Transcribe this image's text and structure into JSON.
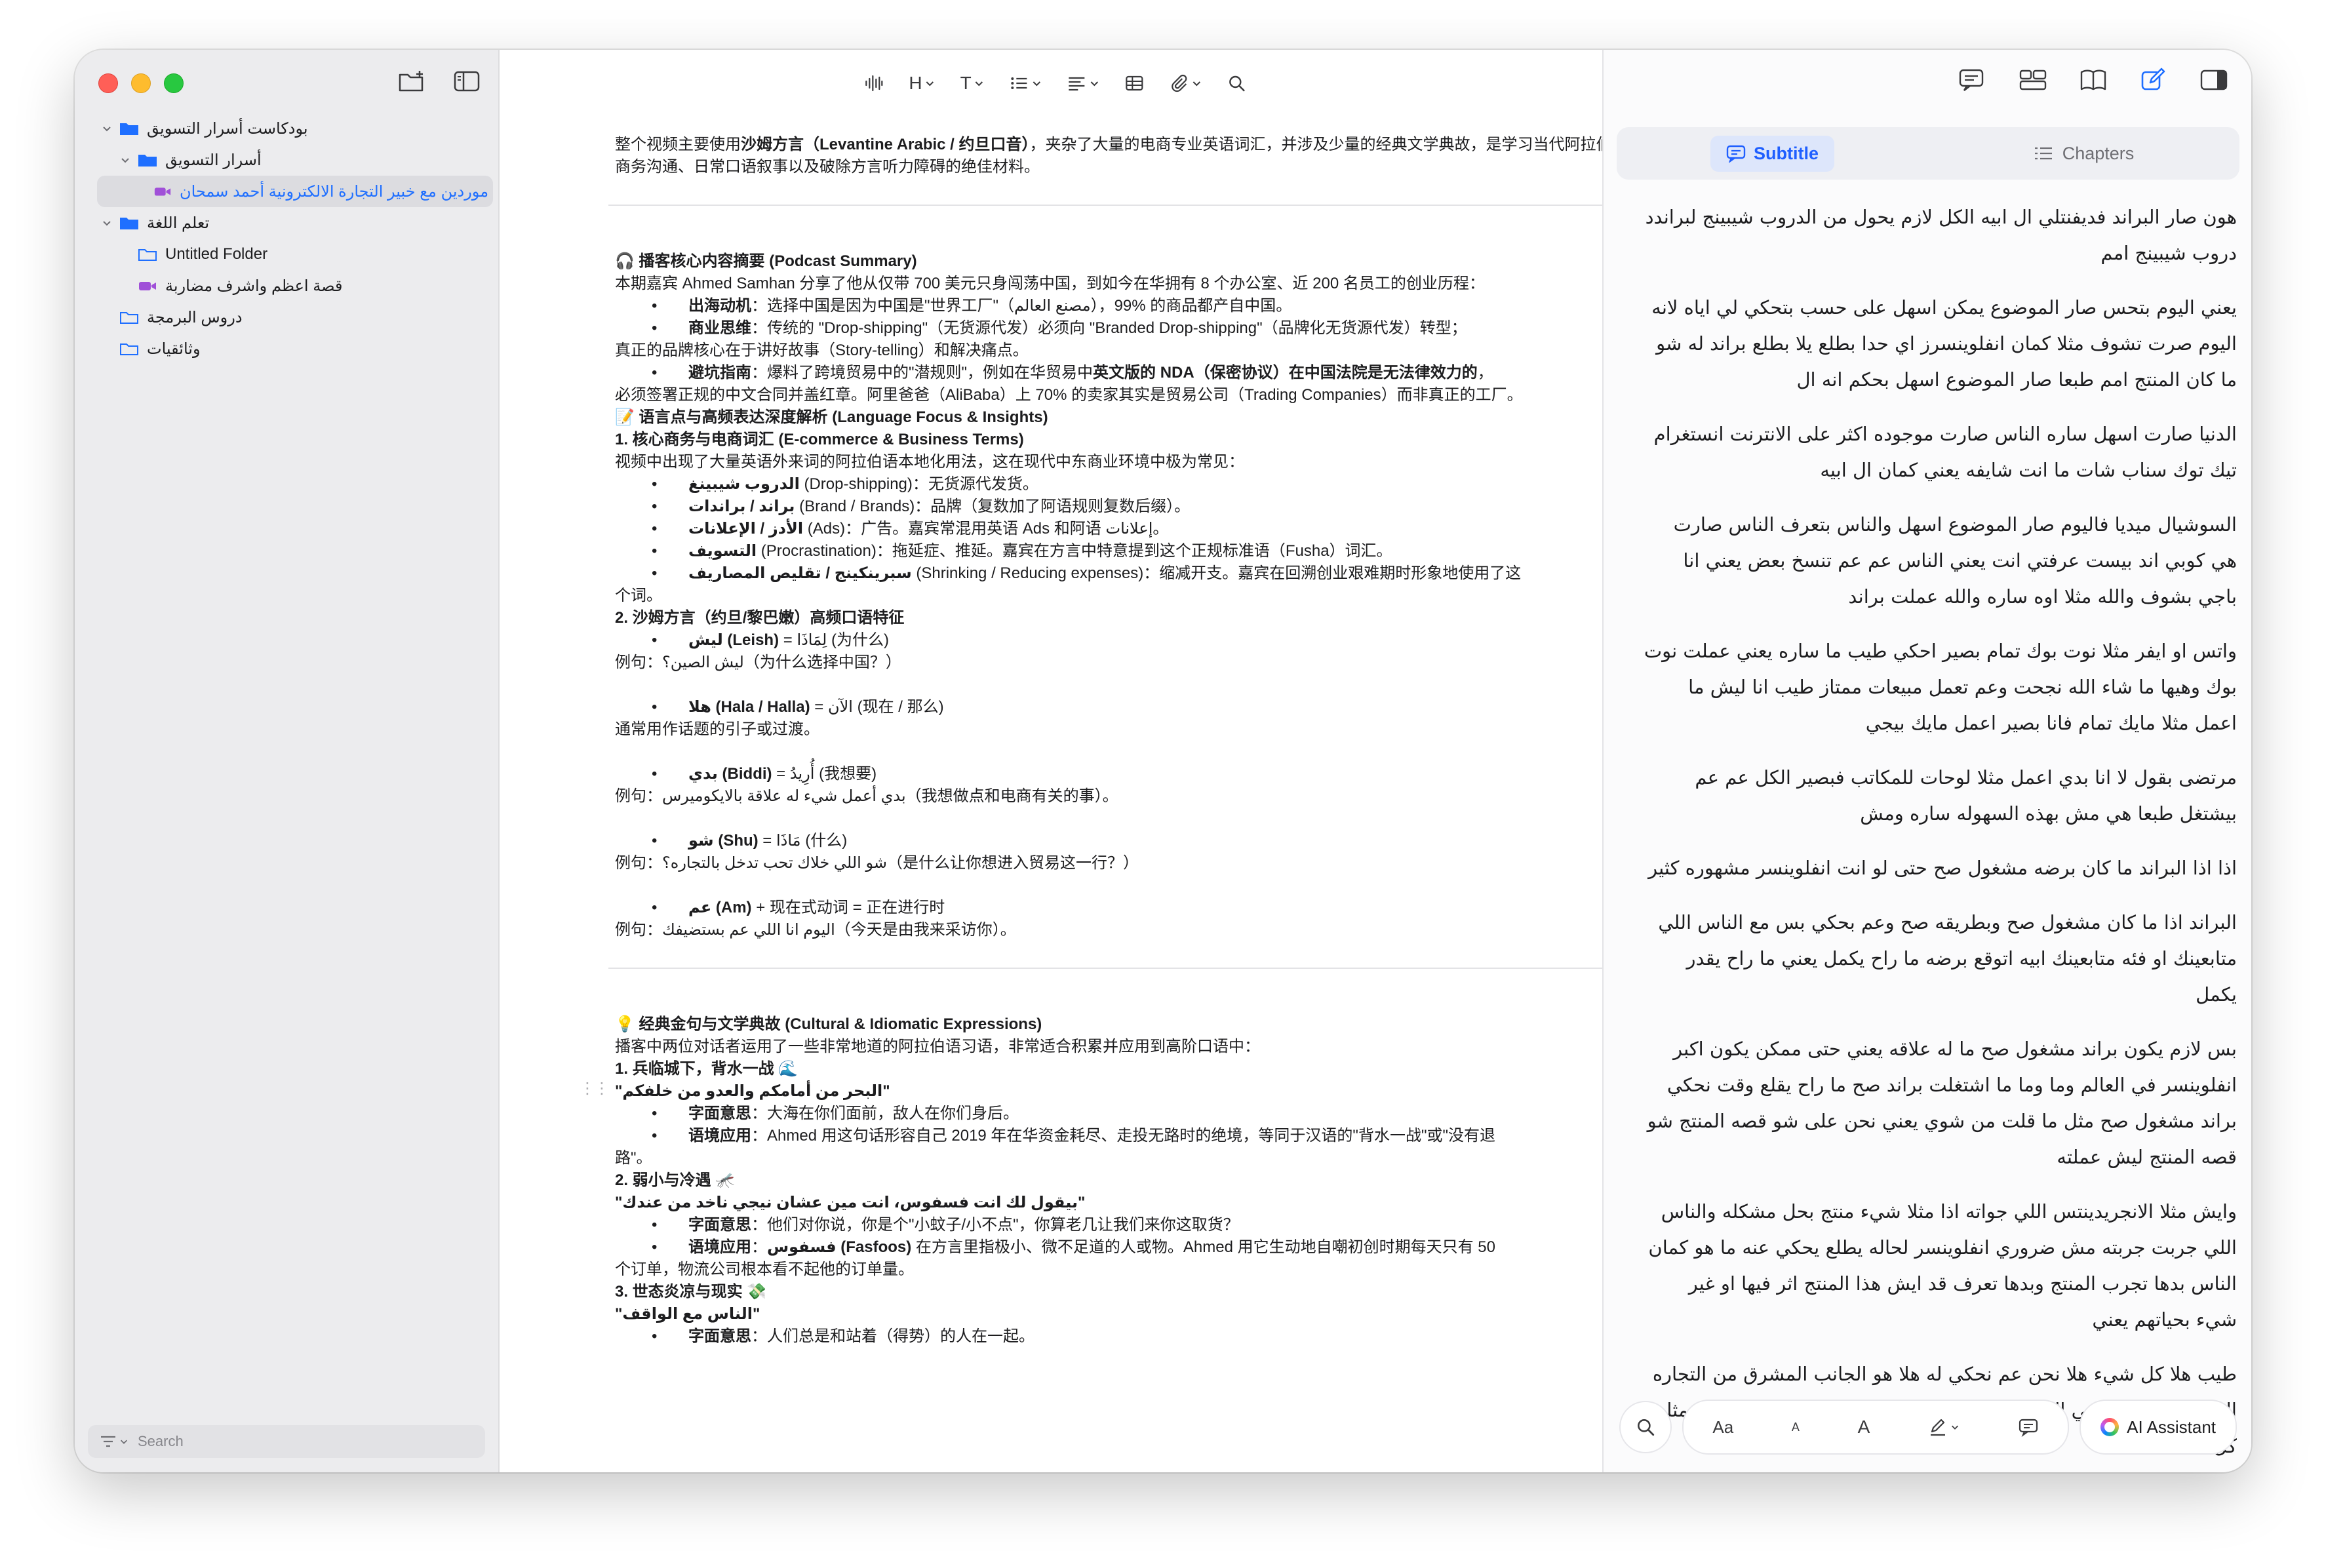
{
  "sidebar": {
    "tree": [
      {
        "label": "بودكاست أسرار التسويق",
        "level": 0,
        "expanded": true,
        "type": "folder-filled"
      },
      {
        "label": "أسرار التسويق",
        "level": 1,
        "expanded": true,
        "type": "folder-filled"
      },
      {
        "label": "موردين مع خبير التجارة الالكترونية أحمد سمحان",
        "level": 2,
        "type": "video",
        "selected": true
      },
      {
        "label": "تعلم اللغة",
        "level": 0,
        "expanded": true,
        "type": "folder-filled"
      },
      {
        "label": "Untitled Folder",
        "level": 1,
        "type": "folder-outline"
      },
      {
        "label": "قصة اعظم واشرف مضاربة",
        "level": 1,
        "type": "video"
      },
      {
        "label": "دروس البرمجة",
        "level": 0,
        "type": "folder-outline"
      },
      {
        "label": "وثائقيات",
        "level": 0,
        "type": "folder-outline"
      }
    ],
    "search_placeholder": "Search"
  },
  "toolbar": {
    "heading": "H",
    "text": "T"
  },
  "doc": {
    "p1a": "整个视频主要使用",
    "p1b": "沙姆方言（Levantine Arabic / 约旦口音）",
    "p1c": "，夹杂了大量的电商专业英语词汇，并涉及少量的经典文学典故，是学习当代阿拉伯语商务沟通、日常口语叙事以及破除方言听力障碍的绝佳材料。",
    "s1_title": "🎧 播客核心内容摘要 (Podcast Summary)",
    "s1_intro": "本期嘉宾 Ahmed Samhan 分享了他从仅带 700 美元只身闯荡中国，到如今在华拥有 8 个办公室、近 200 名员工的创业历程：",
    "b1_head": "出海动机",
    "b1_text": "：选择中国是因为中国是\"世界工厂\"（مصنع العالم），99% 的商品都产自中国。",
    "b2_head": "商业思维",
    "b2_text": "：传统的 \"Drop-shipping\"（无货源代发）必须向 \"Branded Drop-shipping\"（品牌化无货源代发）转型；",
    "b2_cont": "真正的品牌核心在于讲好故事（Story-telling）和解决痛点。",
    "b3_head": "避坑指南",
    "b3_text_a": "：爆料了跨境贸易中的\"潜规则\"，例如在华贸易中",
    "b3_text_b": "英文版的 NDA（保密协议）在中国法院是无法律效力的",
    "b3_text_c": "，",
    "b3_cont": "必须签署正规的中文合同并盖红章。阿里爸爸（AliBaba）上 70% 的卖家其实是贸易公司（Trading Companies）而非真正的工厂。",
    "s2_title": "📝 语言点与高频表达深度解析 (Language Focus & Insights)",
    "s2_h1": "1. 核心商务与电商词汇 (E-commerce & Business Terms)",
    "s2_intro": "视频中出现了大量英语外来词的阿拉伯语本地化用法，这在现代中东商业环境中极为常见：",
    "v1_head": "الدروب شيبينغ",
    "v1_text": " (Drop-shipping)：无货源代发货。",
    "v2_head": "براند / براندات",
    "v2_text": " (Brand / Brands)：品牌（复数加了阿语规则复数后缀）。",
    "v3_head": "الأدز / الإعلانات",
    "v3_text": " (Ads)：广告。嘉宾常混用英语 Ads 和阿语 إعلانات。",
    "v4_head": "التسويف",
    "v4_text": " (Procrastination)：拖延症、推延。嘉宾在方言中特意提到这个正规标准语（Fusha）词汇。",
    "v5_head": "سبرينكينج / تقليص المصاريف",
    "v5_text": " (Shrinking / Reducing expenses)：缩减开支。嘉宾在回溯创业艰难期时形象地使用了这",
    "v5_cont": "个词。",
    "s2_h2": "2. 沙姆方言（约旦/黎巴嫩）高频口语特征",
    "d1_head": "ليش (Leish)",
    "d1_text": " = لِمَاذَا (为什么)",
    "d1_ex": "例句：ليش الصين؟（为什么选择中国？）",
    "d2_head": "هلا (Hala / Halla)",
    "d2_text": " = الآن (现在 / 那么)",
    "d2_ex": "通常用作话题的引子或过渡。",
    "d3_head": "بدي (Biddi)",
    "d3_text": " = أُرِيدُ (我想要)",
    "d3_ex": "例句：بدي أعمل شيء له علاقة بالايكوميرس（我想做点和电商有关的事）。",
    "d4_head": "شو (Shu)",
    "d4_text": " = مَاذَا (什么)",
    "d4_ex": "例句：شو اللي خلاك تحب تدخل بالتجاره؟（是什么让你想进入贸易这一行？）",
    "d5_head": "عم (Am)",
    "d5_text": " + 现在式动词 = 正在进行时",
    "d5_ex": "例句：اليوم انا اللي عم بستضيفك（今天是由我来采访你）。",
    "s3_title": "💡 经典金句与文学典故 (Cultural & Idiomatic Expressions)",
    "s3_intro": "播客中两位对话者运用了一些非常地道的阿拉伯语习语，非常适合积累并应用到高阶口语中：",
    "s3_h1": "1. 兵临城下，背水一战 🌊",
    "s3_q1": "\"البحر من أمامكم والعدو من خلفكم\"",
    "q1_b1_head": "字面意思",
    "q1_b1_text": "：大海在你们面前，敌人在你们身后。",
    "q1_b2_head": "语境应用",
    "q1_b2_text": "：Ahmed 用这句话形容自己 2019 年在华资金耗尽、走投无路时的绝境，等同于汉语的\"背水一战\"或\"没有退",
    "q1_b2_cont": "路\"。",
    "s3_h2": "2. 弱小与冷遇 🦟",
    "s3_q2": "\"بيقول لك انت فسفوس، انت مين عشان نيجي ناخد من عندك\"",
    "q2_b1_head": "字面意思",
    "q2_b1_text": "：他们对你说，你是个\"小蚊子/小不点\"，你算老几让我们来你这取货？",
    "q2_b2_head": "语境应用",
    "q2_b2_text_a": "：",
    "q2_b2_bold": "فسفوس (Fasfoos)",
    "q2_b2_text_b": " 在方言里指极小、微不足道的人或物。Ahmed 用它生动地自嘲初创时期每天只有 50",
    "q2_b2_cont": "个订单，物流公司根本看不起他的订单量。",
    "s3_h3": "3. 世态炎凉与现实 💸",
    "s3_q3": "\"الناس مع الواقف\"",
    "q3_b1_head": "字面意思",
    "q3_b1_text": "：人们总是和站着（得势）的人在一起。"
  },
  "right_panel": {
    "tab_subtitle": "Subtitle",
    "tab_chapters": "Chapters",
    "subtitles": [
      "هون صار البراند فديفنتلي ال ابيه الكل لازم يحول من الدروب شيبينج لبراندد دروب شيبينج امم",
      "يعني اليوم بتحس صار الموضوع يمكن اسهل على حسب بتحكي لي اياه لانه اليوم صرت تشوف مثلا كمان انفلوينسرز اي حدا بطلع يلا بطلع براند له شو ما كان المنتج امم طبعا صار الموضوع اسهل بحكم انه ال",
      "الدنيا صارت اسهل ساره الناس صارت موجوده اكثر على الانترنت انستغرام تيك توك سناب شات ما انت شايفه يعني كمان ال ابيه",
      "السوشيال ميديا فاليوم صار الموضوع اسهل والناس بتعرف الناس صارت هي كوبي اند بيست عرفتي انت يعني الناس عم عم تنسخ بعض يعني انا باجي بشوف والله مثلا اوه ساره والله عملت براند",
      "واتس او ايفر مثلا نوت بوك تمام بصير احكي طيب ما ساره يعني عملت نوت بوك وهيها ما شاء الله نجحت وعم تعمل مبيعات ممتاز طيب انا ليش ما اعمل مثلا مايك تمام فانا بصير اعمل مايك بيجي",
      "مرتضى بقول لا انا بدي اعمل مثلا لوحات للمكاتب فبصير الكل عم عم بيشتغل طبعا هي مش بهذه السهوله ساره ومش",
      "اذا اذا البراند ما كان برضه مشغول صح حتى لو انت انفلوينسر مشهوره كثير",
      "البراند اذا ما كان مشغول صح وبطريقه صح وعم بحكي بس مع الناس اللي متابعينك او فئه متابعينك ابيه اتوقع برضه ما راح يكمل يعني ما راح يقدر يكمل",
      "بس لازم يكون براند مشغول صح ما له علاقه يعني حتى ممكن يكون اكبر انفلوينسر في العالم وما وما ما اشتغلت براند صح ما راح يقلع وقت نحكي براند مشغول صح مثل ما قلت من شوي يعني نحن على شو قصه المنتج شو قصه المنتج ليش عملته",
      "وايش مثلا الانجريدينتس اللي جواته اذا مثلا شيء منتج بحل مشكله والناس اللي جربت جربته مش ضروري انفلوينسر لحاله يطلع يحكي عنه ما هو كمان الناس بدها تجرب المنتج وبدها تعرف قد ايش هذا المنتج اثر فيها او غير شيء بحياتهم يعني",
      "طيب هلا كل شيء هلا نحن عم نحكي له هلا هو الجانب المشرق من التجاره الالكترونيه امم اه في الجانب اللي مش مشرق ايه في الجانب المظلم مثل كل"
    ],
    "bottom": {
      "font_label": "Aa",
      "small_a": "A",
      "big_a": "A",
      "ai_label": "AI Assistant"
    }
  }
}
